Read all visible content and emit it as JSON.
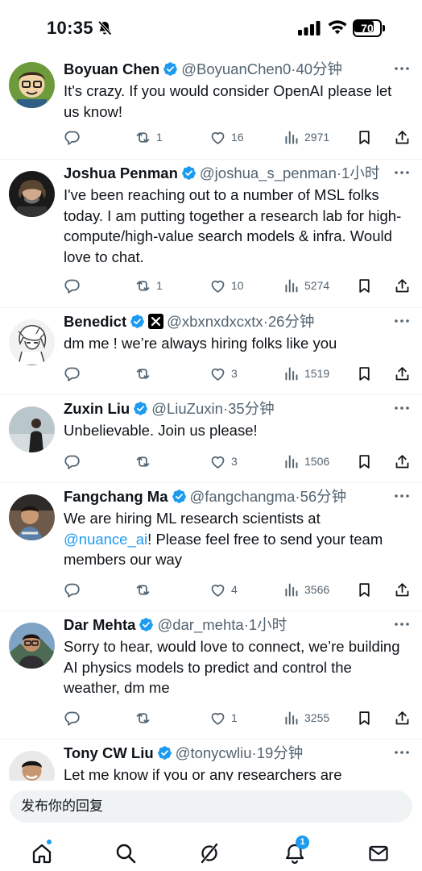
{
  "status_bar": {
    "time": "10:35",
    "battery": "70"
  },
  "tweets": [
    {
      "name": "Boyuan Chen",
      "handle": "@BoyuanChen0",
      "time": "40分钟",
      "text": "It's crazy. If you would consider OpenAI please let us know!",
      "replies": "",
      "reposts": "1",
      "likes": "16",
      "views": "2971"
    },
    {
      "name": "Joshua Penman",
      "handle": "@joshua_s_penman",
      "time": "1小时",
      "text": "I've been reaching out to a number of MSL folks today. I am putting together a research lab for high-compute/high-value search models & infra. Would love to chat.",
      "replies": "",
      "reposts": "1",
      "likes": "10",
      "views": "5274"
    },
    {
      "name": "Benedict",
      "handle": "@xbxnxdxcxtx",
      "time": "26分钟",
      "text": "dm me ! we’re always hiring folks like you",
      "replies": "",
      "reposts": "",
      "likes": "3",
      "views": "1519"
    },
    {
      "name": "Zuxin Liu",
      "handle": "@LiuZuxin",
      "time": "35分钟",
      "text": "Unbelievable. Join us please!",
      "replies": "",
      "reposts": "",
      "likes": "3",
      "views": "1506"
    },
    {
      "name": "Fangchang Ma",
      "handle": "@fangchangma",
      "time": "56分钟",
      "text_before": "We are hiring ML research scientists at ",
      "mention": "@nuance_ai",
      "text_after": "! Please feel free to send your team members our way",
      "replies": "",
      "reposts": "",
      "likes": "4",
      "views": "3566"
    },
    {
      "name": "Dar Mehta",
      "handle": "@dar_mehta",
      "time": "1小时",
      "text": "Sorry to hear, would love to connect, we’re building AI physics models to predict and control the weather, dm me",
      "replies": "",
      "reposts": "",
      "likes": "1",
      "views": "3255"
    },
    {
      "name": "Tony CW Liu",
      "handle": "@tonycwliu",
      "time": "19分钟",
      "text": "Let me know if you or any researchers are"
    }
  ],
  "separator": "·",
  "reply_bar": {
    "placeholder": "发布你的回复"
  },
  "tabbar": {
    "notifications_badge": "1"
  },
  "colors": {
    "accent": "#1d9bf0",
    "text": "#0f1419",
    "muted": "#536471",
    "divider": "#eff3f4"
  }
}
